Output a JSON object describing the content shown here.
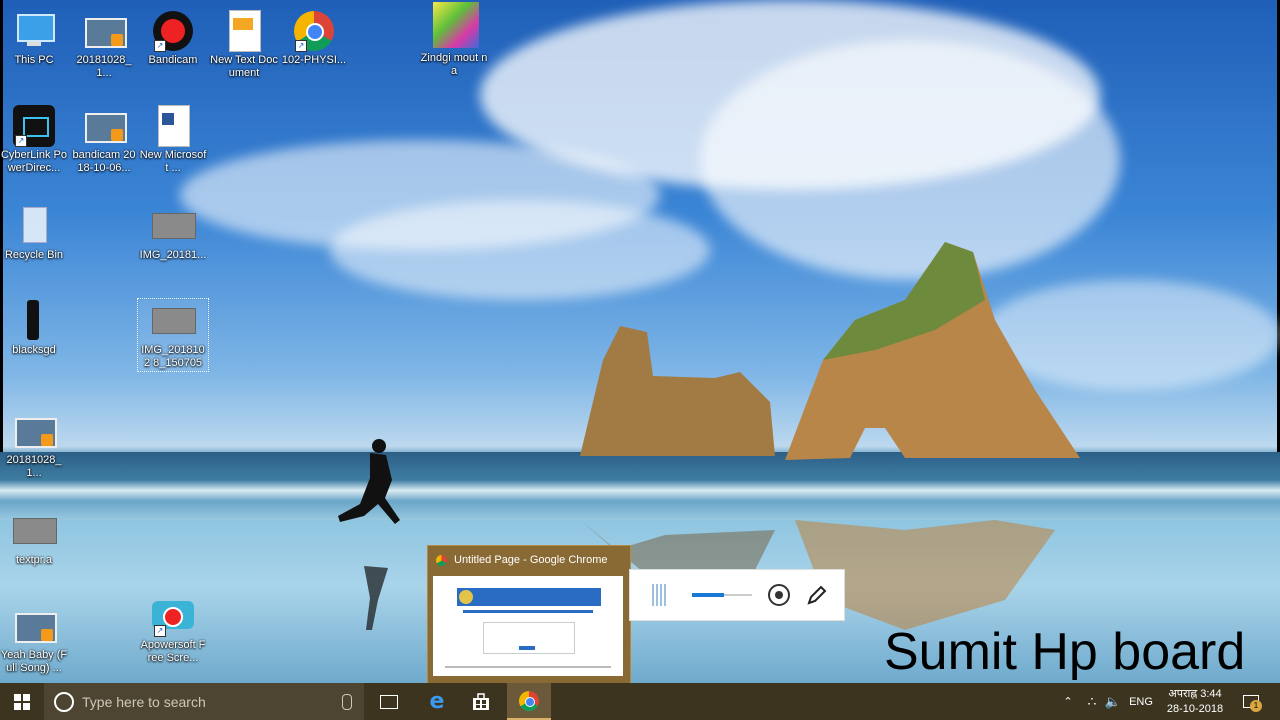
{
  "desktop": {
    "icons": [
      {
        "label": "This PC",
        "icon": "computer-icon"
      },
      {
        "label": "20181028_1...",
        "icon": "video-file-icon"
      },
      {
        "label": "Bandicam",
        "icon": "bandicam-icon"
      },
      {
        "label": "New Text Document",
        "icon": "text-document-icon"
      },
      {
        "label": "102-PHYSI...",
        "icon": "chrome-icon"
      },
      {
        "label": "Zindgi mout na",
        "icon": "songs-image-icon"
      },
      {
        "label": "CyberLink PowerDirec...",
        "icon": "powerdirector-icon"
      },
      {
        "label": "bandicam 2018-10-06...",
        "icon": "video-file-icon"
      },
      {
        "label": "New Microsoft ...",
        "icon": "word-document-icon"
      },
      {
        "label": "Recycle Bin",
        "icon": "recycle-bin-icon"
      },
      {
        "label": "IMG_20181...",
        "icon": "image-file-icon"
      },
      {
        "label": "blacksgd",
        "icon": "black-image-icon"
      },
      {
        "label": "IMG_2018102 8_150705",
        "icon": "image-file-icon"
      },
      {
        "label": "20181028_1...",
        "icon": "video-file-icon"
      },
      {
        "label": "textpr.a",
        "icon": "image-file-icon"
      },
      {
        "label": "Yeah Baby (Full Song) ...",
        "icon": "video-file-icon"
      },
      {
        "label": "Apowersoft Free Scre...",
        "icon": "apowersoft-recorder-icon"
      }
    ]
  },
  "thumbnail": {
    "title": "Untitled Page - Google Chrome"
  },
  "watermark": "Sumit Hp board",
  "taskbar": {
    "search_placeholder": "Type here to search",
    "language": "ENG",
    "time": "अपराह्न 3:44",
    "date": "28-10-2018",
    "notification_count": "1"
  },
  "colors": {
    "taskbar_bg": "#3d3420",
    "search_bg": "#4d4431",
    "thumbnail_bg": "#8a6a34"
  }
}
